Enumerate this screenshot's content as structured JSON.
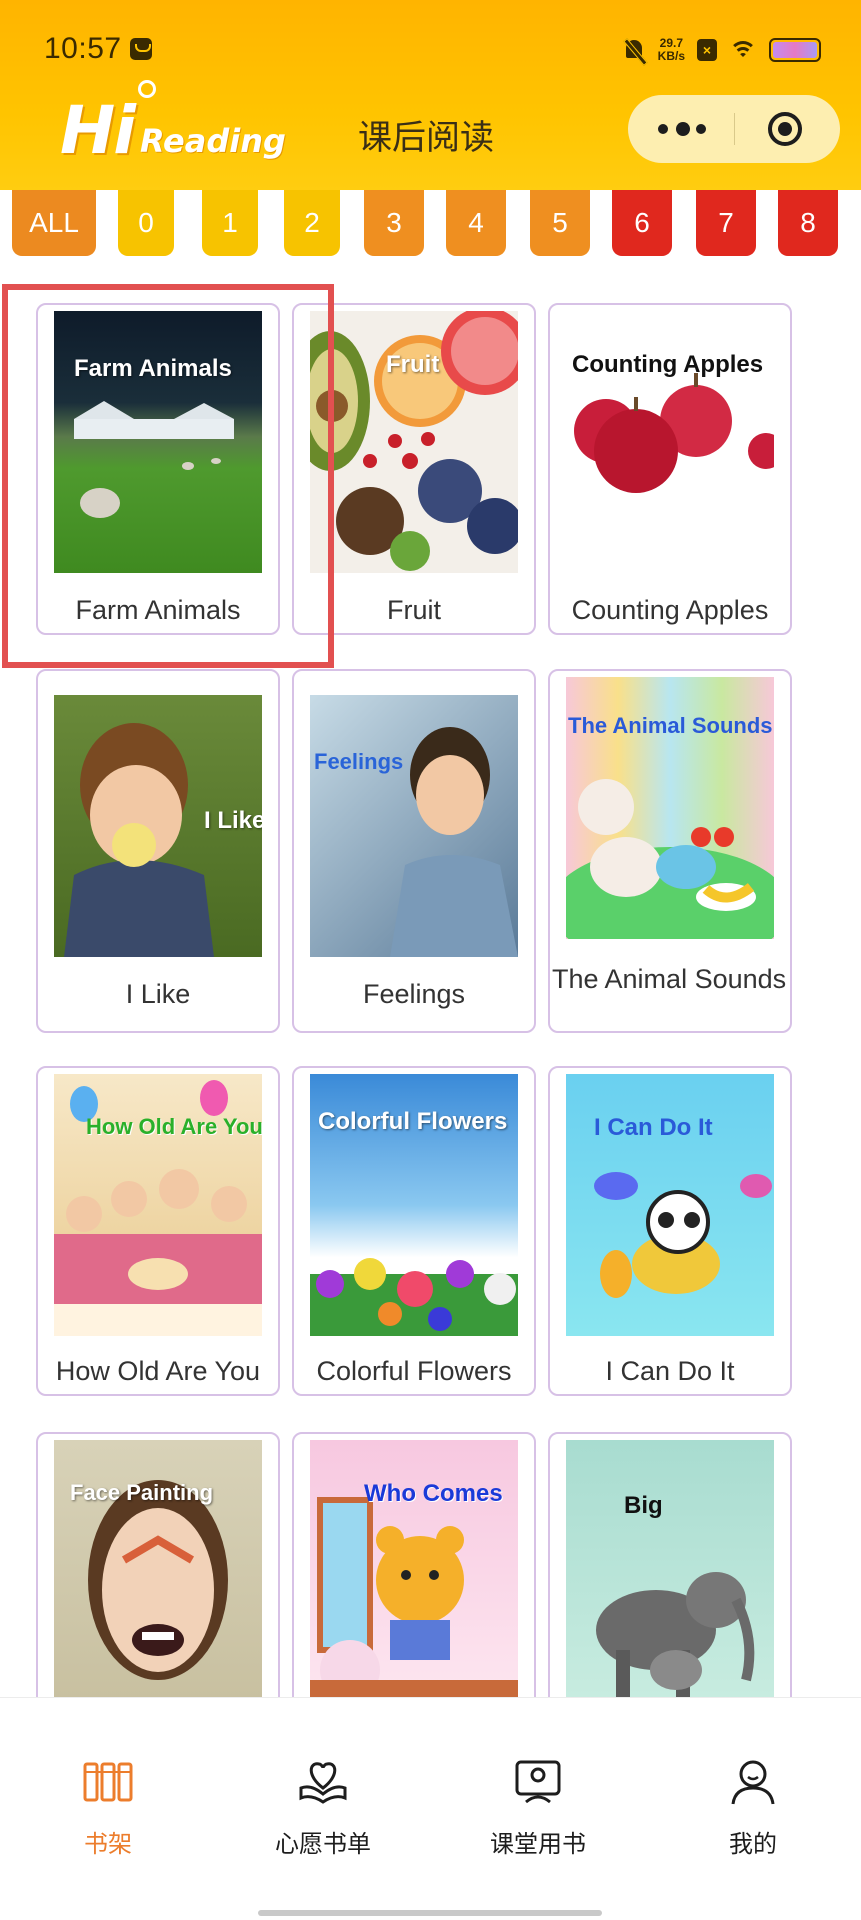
{
  "status_bar": {
    "time": "10:57",
    "net_speed_value": "29.7",
    "net_speed_unit": "KB/s"
  },
  "header": {
    "logo_hi": "Hi",
    "logo_reading": "Reading",
    "title": "课后阅读"
  },
  "levels": [
    {
      "label": "ALL",
      "color": "#ec8a20"
    },
    {
      "label": "0",
      "color": "#f7c300"
    },
    {
      "label": "1",
      "color": "#f7c300"
    },
    {
      "label": "2",
      "color": "#f7c300"
    },
    {
      "label": "3",
      "color": "#ef8f20"
    },
    {
      "label": "4",
      "color": "#ef8f20"
    },
    {
      "label": "5",
      "color": "#ef8f20"
    },
    {
      "label": "6",
      "color": "#e0281e"
    },
    {
      "label": "7",
      "color": "#e0281e"
    },
    {
      "label": "8",
      "color": "#e0281e"
    }
  ],
  "books": [
    {
      "title": "Farm Animals",
      "cover_text": "Farm Animals"
    },
    {
      "title": "Fruit",
      "cover_text": "Fruit"
    },
    {
      "title": "Counting Apples",
      "cover_text": "Counting Apples"
    },
    {
      "title": "I Like",
      "cover_text": "I Like"
    },
    {
      "title": "Feelings",
      "cover_text": "Feelings"
    },
    {
      "title": "The Animal Sounds",
      "cover_text": "The Animal Sounds"
    },
    {
      "title": "How Old Are You",
      "cover_text": "How Old Are You?"
    },
    {
      "title": "Colorful Flowers",
      "cover_text": "Colorful Flowers"
    },
    {
      "title": "I Can Do It",
      "cover_text": "I Can Do It"
    },
    {
      "title": "",
      "cover_text": "Face Painting"
    },
    {
      "title": "",
      "cover_text": "Who Comes"
    },
    {
      "title": "",
      "cover_text": "Big"
    }
  ],
  "bottom_nav": [
    {
      "label": "书架",
      "icon": "bookshelf-icon",
      "active": true
    },
    {
      "label": "心愿书单",
      "icon": "wishlist-heart-book-icon",
      "active": false
    },
    {
      "label": "课堂用书",
      "icon": "classroom-book-icon",
      "active": false
    },
    {
      "label": "我的",
      "icon": "profile-icon",
      "active": false
    }
  ],
  "colors": {
    "accent": "#ec7d2c",
    "header_yellow": "#ffc400",
    "card_border": "#d7c1e6",
    "highlight_red": "#e25050"
  }
}
